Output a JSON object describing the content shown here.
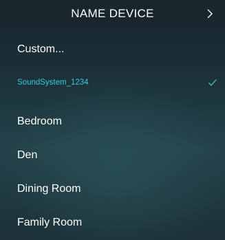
{
  "header": {
    "title": "NAME DEVICE",
    "next_icon": "chevron-right-icon"
  },
  "colors": {
    "header_background": "#1a262e",
    "selected_accent": "#38c9e0",
    "checkmark": "#3bc8a0",
    "text": "#ffffff"
  },
  "options": [
    {
      "label": "Custom...",
      "selected": false
    },
    {
      "label": "SoundSystem_1234",
      "selected": true,
      "check_icon": "checkmark-icon"
    },
    {
      "label": "Bedroom",
      "selected": false
    },
    {
      "label": "Den",
      "selected": false
    },
    {
      "label": "Dining Room",
      "selected": false
    },
    {
      "label": "Family Room",
      "selected": false
    }
  ]
}
